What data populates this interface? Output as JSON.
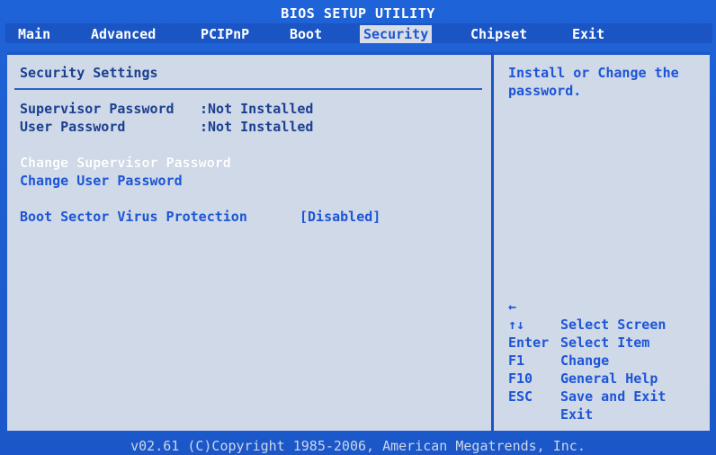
{
  "title": "BIOS SETUP UTILITY",
  "menu": [
    {
      "label": "Main",
      "selected": false
    },
    {
      "label": "Advanced",
      "selected": false
    },
    {
      "label": "PCIPnP",
      "selected": false
    },
    {
      "label": "Boot",
      "selected": false
    },
    {
      "label": "Security",
      "selected": true
    },
    {
      "label": "Chipset",
      "selected": false
    },
    {
      "label": "Exit",
      "selected": false
    }
  ],
  "main": {
    "section_title": "Security Settings",
    "supervisor_password_label": "Supervisor Password",
    "supervisor_password_value": ":Not Installed",
    "user_password_label": "User Password",
    "user_password_value": ":Not Installed",
    "change_supervisor_password": "Change Supervisor Password",
    "change_user_password": "Change User Password",
    "boot_sector_virus_protection_label": "Boot Sector Virus Protection",
    "boot_sector_virus_protection_value": "[Disabled]"
  },
  "help": {
    "description_line1": "Install or Change the",
    "description_line2": "password.",
    "keys": [
      {
        "key": "←",
        "desc": "Select Screen"
      },
      {
        "key": "↑↓",
        "desc": "Select Item"
      },
      {
        "key": "Enter",
        "desc": "Change"
      },
      {
        "key": "F1",
        "desc": "General Help"
      },
      {
        "key": "F10",
        "desc": "Save and Exit"
      },
      {
        "key": "ESC",
        "desc": "Exit"
      }
    ]
  },
  "footer": "v02.61 (C)Copyright 1985-2006, American Megatrends, Inc."
}
